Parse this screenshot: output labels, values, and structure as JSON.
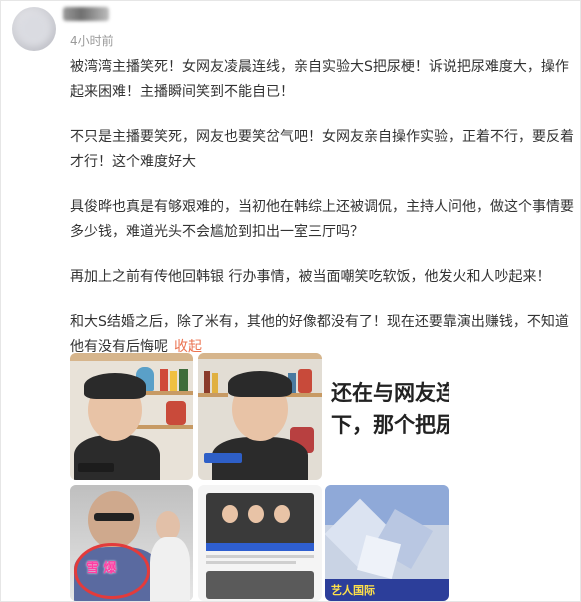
{
  "post": {
    "time": "4小时前",
    "paragraphs": [
      "被湾湾主播笑死！女网友凌晨连线，亲自实验大S把尿梗！诉说把尿难度大，操作起来困难！主播瞬间笑到不能自已！",
      "不只是主播要笑死，网友也要笑岔气吧！女网友亲自操作实验，正着不行，要反着才行！这个难度好大",
      "具俊晔也真是有够艰难的，当初他在韩综上还被调侃，主持人问他，做这个事情要多少钱，难道光头不会尴尬到扣出一室三厅吗？",
      "再加上之前有传他回韩银 行办事情，被当面嘲笑吃软饭，他发火和人吵起来！",
      "和大S结婚之后，除了米有，其他的好像都没有了！现在还要靠演出赚钱，不知道他有没有后悔呢"
    ],
    "collapse_label": "收起"
  },
  "images": {
    "thumb3_line1": "还在与网友连线",
    "thumb3_line2": "下，那个把尿，",
    "thumb4_pink": "雪 爆",
    "thumb6_footer": "艺人国际"
  },
  "colors": {
    "link": "#eb7350",
    "time": "#9a9a9a",
    "body_text": "#333333"
  }
}
